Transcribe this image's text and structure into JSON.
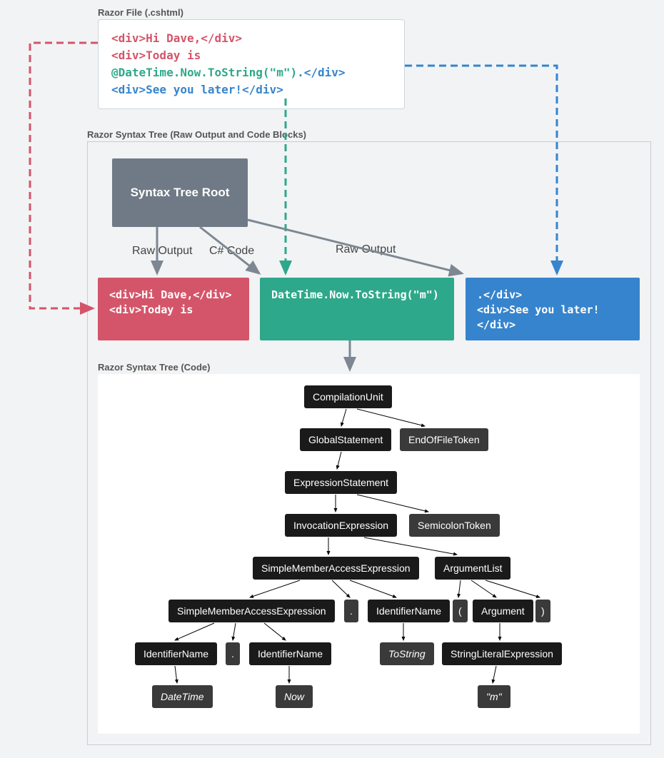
{
  "labels": {
    "razor_file": "Razor File (.cshtml)",
    "syntax_tree_raw": "Razor Syntax Tree (Raw Output and Code Blocks)",
    "syntax_tree_code": "Razor Syntax Tree (Code)"
  },
  "razor_file": {
    "line1": "<div>Hi Dave,</div>",
    "line2_prefix": "<div>Today is ",
    "line2_code": "@DateTime.Now.ToString(\"m\")",
    "line2_suffix": ".</div>",
    "line3": "<div>See you later!</div>"
  },
  "root": {
    "label": "Syntax Tree Root"
  },
  "edge_labels": {
    "raw1": "Raw Output",
    "code": "C# Code",
    "raw2": "Raw Output"
  },
  "mid_boxes": {
    "red_l1": "<div>Hi Dave,</div>",
    "red_l2": "<div>Today is",
    "green": "DateTime.Now.ToString(\"m\")",
    "blue_l1": ".</div>",
    "blue_l2": "<div>See you later!</div>"
  },
  "ast": {
    "compilation_unit": "CompilationUnit",
    "global_statement": "GlobalStatement",
    "eof_token": "EndOfFileToken",
    "expression_statement": "ExpressionStatement",
    "invocation_expression": "InvocationExpression",
    "semicolon_token": "SemicolonToken",
    "sma1": "SimpleMemberAccessExpression",
    "argument_list": "ArgumentList",
    "sma2": "SimpleMemberAccessExpression",
    "dot1": ".",
    "id_name1": "IdentifierName",
    "lparen": "(",
    "argument": "Argument",
    "rparen": ")",
    "id_name2": "IdentifierName",
    "dot2": ".",
    "id_name3": "IdentifierName",
    "tostring": "ToString",
    "string_lit": "StringLiteralExpression",
    "datetime": "DateTime",
    "now": "Now",
    "m": "\"m\""
  },
  "colors": {
    "red": "#d4556a",
    "green": "#2ea88a",
    "blue": "#3684cd",
    "grey_arrow": "#7d8791"
  }
}
